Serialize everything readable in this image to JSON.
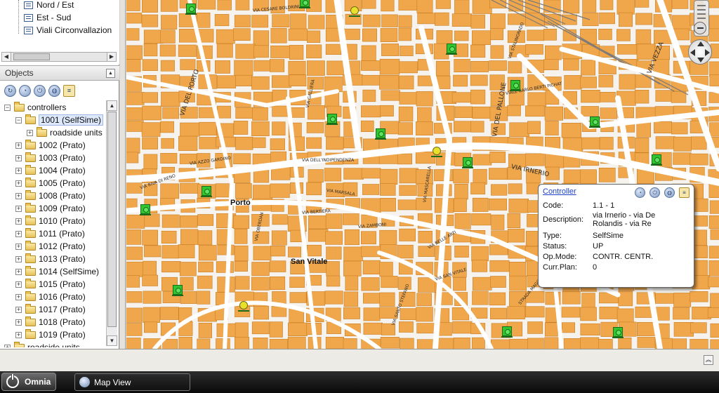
{
  "layers": {
    "items": [
      {
        "label": "Nord / Est"
      },
      {
        "label": "Est - Sud"
      },
      {
        "label": "Viali Circonvallazion"
      }
    ]
  },
  "objects_panel": {
    "title": "Objects",
    "toolbar_icons": [
      "refresh-icon",
      "gauge-icon",
      "power-icon",
      "globe-icon",
      "table-icon"
    ],
    "tree": {
      "root": "controllers",
      "selected": "1001 (SelfSime)",
      "child": "roadside units",
      "items": [
        {
          "label": "1002 (Prato)"
        },
        {
          "label": "1003 (Prato)"
        },
        {
          "label": "1004 (Prato)"
        },
        {
          "label": "1005 (Prato)"
        },
        {
          "label": "1008 (Prato)"
        },
        {
          "label": "1009 (Prato)"
        },
        {
          "label": "1010 (Prato)"
        },
        {
          "label": "1011 (Prato)"
        },
        {
          "label": "1012 (Prato)"
        },
        {
          "label": "1013 (Prato)"
        },
        {
          "label": "1014 (SelfSime)"
        },
        {
          "label": "1015 (Prato)"
        },
        {
          "label": "1016 (Prato)"
        },
        {
          "label": "1017 (Prato)"
        },
        {
          "label": "1018 (Prato)"
        },
        {
          "label": "1019 (Prato)"
        }
      ],
      "trailing": "roadside units"
    }
  },
  "map": {
    "places": {
      "porto": "Porto",
      "san_vitale": "San Vitale"
    },
    "streets": {
      "via_irnerio": "VIA IRNERIO",
      "via_del_pallone": "VIA DEL PALLONE",
      "via_galliera": "VIA GALLIERA",
      "via_del_porto": "VIA DEL PORTO",
      "via_vezza": "VIA VEZZA",
      "viale_berti_pichat": "VIALE CARLO BERTI PICHAT",
      "via_stalingrado": "VIA STALINGRADO",
      "via_cesare_boldrini": "VIA CESARE BOLDRINI",
      "via_mascarella": "VIA MASCARELLA",
      "via_belle_arti": "VIA BELLE ARTI",
      "via_san_vitale": "VIA SAN VITALE",
      "via_riva_di_reno": "VIA RIVA DI RENO",
      "via_indipendenza": "VIA DELL'INDIPENDENZA",
      "via_marsala": "VIA MARSALA",
      "via_zamboni": "VIA ZAMBONI",
      "strada_maggiore": "STRADA MAGGIORE",
      "via_santo_stefano": "VIA SANTO STEFANO",
      "via_azzo_gardino": "VIA AZZO GARDINO",
      "via_bertiera": "VIA BERTIERA",
      "via_oberdan": "VIA OBERDAN"
    },
    "signal_status": {
      "ok_color": "#2fc62f",
      "warn_color": "#e8e02a"
    }
  },
  "popup": {
    "title": "Controller",
    "icons": [
      "gauge-icon",
      "power-icon",
      "globe-icon",
      "table-icon"
    ],
    "fields": {
      "code_label": "Code:",
      "code_value": "1.1 - 1",
      "desc_label": "Description:",
      "desc_value": "via Irnerio - via De Rolandis - via Re",
      "type_label": "Type:",
      "type_value": "SelfSime",
      "status_label": "Status:",
      "status_value": "UP",
      "opmode_label": "Op.Mode:",
      "opmode_value": "CONTR. CENTR.",
      "plan_label": "Curr.Plan:",
      "plan_value": "0"
    }
  },
  "taskbar": {
    "start_label": "Omnia",
    "task_label": "Map View"
  },
  "colors": {
    "building": "#f0a64a",
    "road": "#ffffff",
    "accent_link": "#1d42c8"
  }
}
